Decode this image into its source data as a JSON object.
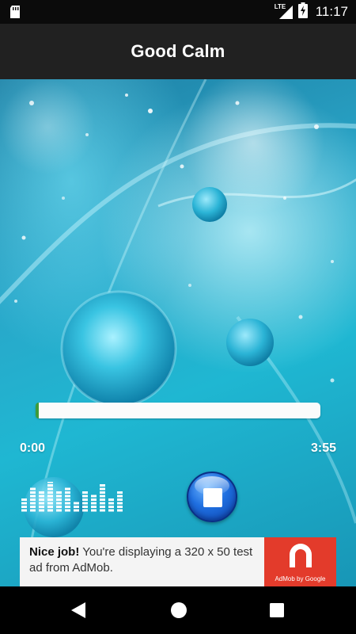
{
  "status_bar": {
    "time": "11:17",
    "network": "LTE",
    "icons": [
      "sd-card-icon",
      "signal-icon",
      "battery-charging-icon"
    ]
  },
  "app_bar": {
    "title": "Good Calm"
  },
  "player": {
    "elapsed": "0:00",
    "duration": "3:55",
    "progress_fraction": 0.01,
    "control": "stop-icon",
    "equalizer": "equalizer-icon"
  },
  "ad": {
    "headline": "Nice job!",
    "body": " You're displaying a 320 x 50 test ad from AdMob.",
    "brand": "AdMob by Google",
    "brand_color": "#e33b2b"
  },
  "nav": {
    "icons": [
      "back-icon",
      "home-icon",
      "recent-apps-icon"
    ]
  }
}
